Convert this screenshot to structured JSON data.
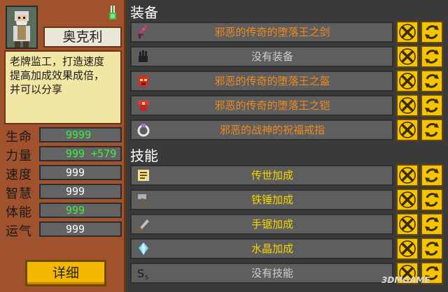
{
  "character": {
    "name": "奥克利",
    "description_lines": [
      "老牌监工，打造速度",
      "提高加成效果成倍，",
      "并可以分享"
    ],
    "detail_button": "详细"
  },
  "stats": [
    {
      "label": "生命",
      "value": "9999",
      "bonus": "",
      "green": true
    },
    {
      "label": "力量",
      "value": "999",
      "bonus": "+579",
      "green": true
    },
    {
      "label": "速度",
      "value": "999",
      "bonus": "",
      "green": false
    },
    {
      "label": "智慧",
      "value": "999",
      "bonus": "",
      "green": false
    },
    {
      "label": "体能",
      "value": "999",
      "bonus": "",
      "green": true
    },
    {
      "label": "运气",
      "value": "999",
      "bonus": "",
      "green": false
    }
  ],
  "equipment": {
    "title": "装备",
    "items": [
      {
        "label": "邪恶的传奇的堕落王之剑",
        "icon": "sword-icon",
        "style": "orange"
      },
      {
        "label": "没有装备",
        "icon": "glove-icon",
        "style": "gray"
      },
      {
        "label": "邪恶的传奇的堕落王之盔",
        "icon": "helmet-icon",
        "style": "orange"
      },
      {
        "label": "邪恶的传奇的堕落王之铠",
        "icon": "armor-icon",
        "style": "orange"
      },
      {
        "label": "邪恶的战神的祝福戒指",
        "icon": "ring-icon",
        "style": "orange"
      }
    ]
  },
  "skills": {
    "title": "技能",
    "items": [
      {
        "label": "传世加成",
        "icon": "scroll-icon",
        "style": "yellow"
      },
      {
        "label": "铁锤加成",
        "icon": "hammer-icon",
        "style": "yellow"
      },
      {
        "label": "手锯加成",
        "icon": "saw-icon",
        "style": "yellow"
      },
      {
        "label": "水晶加成",
        "icon": "crystal-icon",
        "style": "yellow"
      },
      {
        "label": "没有技能",
        "icon": "empty-skill-icon",
        "style": "gray"
      }
    ]
  },
  "watermark": "3DMGAME",
  "colors": {
    "orange_text": "#f08a1c",
    "yellow_text": "#f5d400",
    "stat_green": "#3ef03e",
    "button_yellow": "#f5c400"
  }
}
